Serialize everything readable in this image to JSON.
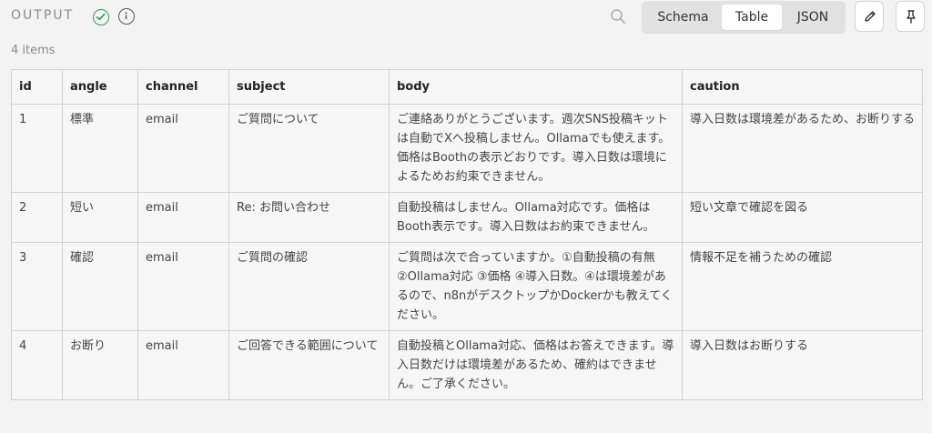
{
  "panel": {
    "title": "OUTPUT",
    "count_label": "4 items",
    "views": [
      "Schema",
      "Table",
      "JSON"
    ],
    "active_view": "Table",
    "status_color": "#2a9d58"
  },
  "table": {
    "columns": [
      "id",
      "angle",
      "channel",
      "subject",
      "body",
      "caution"
    ],
    "rows": [
      {
        "id": "1",
        "angle": "標準",
        "channel": "email",
        "subject": "ご質問について",
        "body": "ご連絡ありがとうございます。週次SNS投稿キットは自動でXへ投稿しません。Ollamaでも使えます。価格はBoothの表示どおりです。導入日数は環境によるためお約束できません。",
        "caution": "導入日数は環境差があるため、お断りする"
      },
      {
        "id": "2",
        "angle": "短い",
        "channel": "email",
        "subject": "Re: お問い合わせ",
        "body": "自動投稿はしません。Ollama対応です。価格はBooth表示です。導入日数はお約束できません。",
        "caution": "短い文章で確認を図る"
      },
      {
        "id": "3",
        "angle": "確認",
        "channel": "email",
        "subject": "ご質問の確認",
        "body": "ご質問は次で合っていますか。①自動投稿の有無 ②Ollama対応 ③価格 ④導入日数。④は環境差があるので、n8nがデスクトップかDockerかも教えてください。",
        "caution": "情報不足を補うための確認"
      },
      {
        "id": "4",
        "angle": "お断り",
        "channel": "email",
        "subject": "ご回答できる範囲について",
        "body": "自動投稿とOllama対応、価格はお答えできます。導入日数だけは環境差があるため、確約はできません。ご了承ください。",
        "caution": "導入日数はお断りする"
      }
    ]
  }
}
